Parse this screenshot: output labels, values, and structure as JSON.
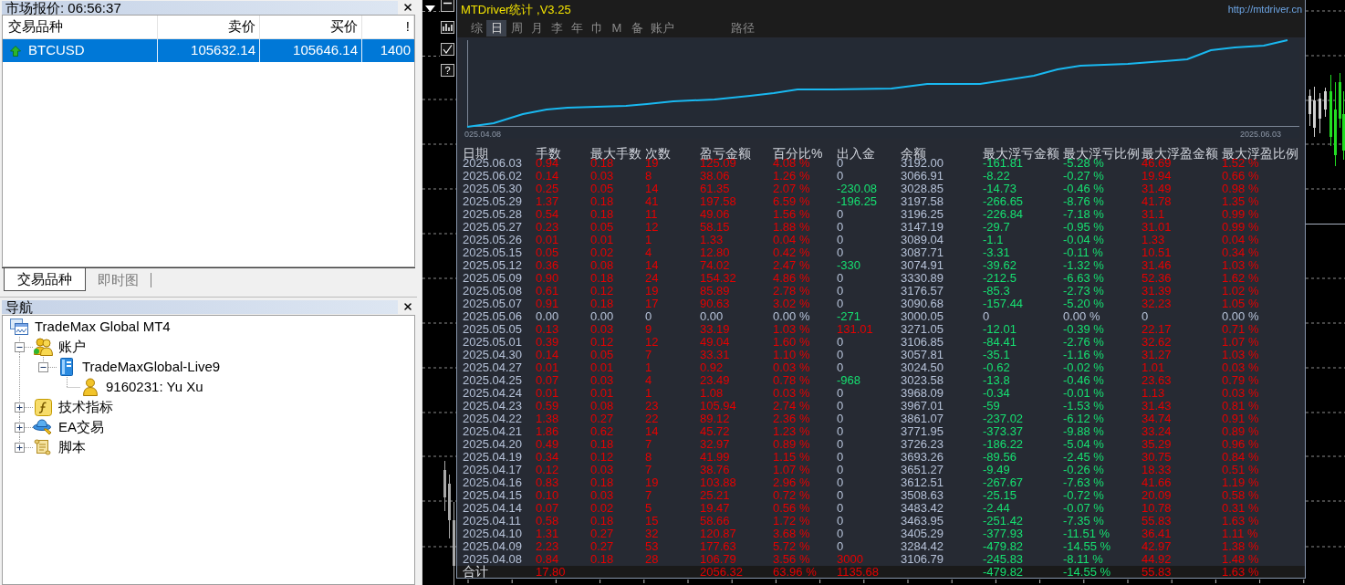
{
  "market_watch": {
    "title": "市场报价: 06:56:37",
    "columns": [
      "交易品种",
      "卖价",
      "买价",
      "!"
    ],
    "rows": [
      {
        "symbol": "BTCUSD",
        "kind": "up",
        "bid": "105632.14",
        "ask": "105646.14",
        "spread": "1400",
        "selected": true
      }
    ],
    "tabs": [
      {
        "label": "交易品种",
        "selected": true
      },
      {
        "label": "即时图",
        "selected": false
      }
    ]
  },
  "navigator": {
    "title": "导航",
    "tree": [
      {
        "label": "TradeMax Global MT4",
        "kind": "terminal",
        "children": [
          {
            "label": "账户",
            "kind": "accounts",
            "expanded": true,
            "children": [
              {
                "label": "TradeMaxGlobal-Live9",
                "kind": "server",
                "expanded": true,
                "children": [
                  {
                    "label": "9160231: Yu Xu",
                    "kind": "user"
                  }
                ]
              }
            ]
          },
          {
            "label": "技术指标",
            "kind": "indicators",
            "expanded": false
          },
          {
            "label": "EA交易",
            "kind": "experts",
            "expanded": false
          },
          {
            "label": "脚本",
            "kind": "scripts",
            "expanded": false
          }
        ]
      }
    ]
  },
  "side_toolbar": {
    "help_label": "?"
  },
  "stats": {
    "title": "MTDriver统计 ,V3.25",
    "link": "http://mtdriver.cn",
    "tabs": [
      {
        "label": "综",
        "selected": false
      },
      {
        "label": "日",
        "selected": true
      },
      {
        "label": "周",
        "selected": false
      },
      {
        "label": "月",
        "selected": false
      },
      {
        "label": "李",
        "selected": false
      },
      {
        "label": "年",
        "selected": false
      },
      {
        "label": "巾",
        "selected": false
      },
      {
        "label": "M",
        "selected": false
      },
      {
        "label": "备",
        "selected": false
      },
      {
        "label": "账户",
        "selected": false
      }
    ],
    "path_button": "路径",
    "curve": {
      "start_label": "025.04.08",
      "end_label": "2025.06.03"
    },
    "columns": [
      {
        "label": "日期",
        "kind": "neutral"
      },
      {
        "label": "手数",
        "kind": "positive"
      },
      {
        "label": "最大手数",
        "kind": "positive"
      },
      {
        "label": "次数",
        "kind": "positive"
      },
      {
        "label": "盈亏金额",
        "kind": "positive"
      },
      {
        "label": "百分比%",
        "kind": "positive"
      },
      {
        "label": "出入金",
        "kind": "flow"
      },
      {
        "label": "余额",
        "kind": "neutral"
      },
      {
        "label": "最大浮亏金额",
        "kind": "negative"
      },
      {
        "label": "最大浮亏比例",
        "kind": "negative"
      },
      {
        "label": "最大浮盈金额",
        "kind": "positive"
      },
      {
        "label": "最大浮盈比例",
        "kind": "positive"
      }
    ],
    "rows": [
      {
        "cells": [
          "2025.06.03",
          "0.94",
          "0.18",
          "19",
          "125.09",
          "4.08 %",
          "0",
          "3192.00",
          "-161.81",
          "-5.28 %",
          "46.69",
          "1.52 %"
        ],
        "idle": false,
        "kind": "none"
      },
      {
        "cells": [
          "2025.06.02",
          "0.14",
          "0.03",
          "8",
          "38.06",
          "1.26 %",
          "0",
          "3066.91",
          "-8.22",
          "-0.27 %",
          "19.94",
          "0.66 %"
        ],
        "idle": false,
        "kind": "none"
      },
      {
        "cells": [
          "2025.05.30",
          "0.25",
          "0.05",
          "14",
          "61.35",
          "2.07 %",
          "-230.08",
          "3028.85",
          "-14.73",
          "-0.46 %",
          "31.49",
          "0.98 %"
        ],
        "idle": false,
        "kind": "withdrawal"
      },
      {
        "cells": [
          "2025.05.29",
          "1.37",
          "0.18",
          "41",
          "197.58",
          "6.59 %",
          "-196.25",
          "3197.58",
          "-266.65",
          "-8.76 %",
          "41.78",
          "1.35 %"
        ],
        "idle": false,
        "kind": "withdrawal"
      },
      {
        "cells": [
          "2025.05.28",
          "0.54",
          "0.18",
          "11",
          "49.06",
          "1.56 %",
          "0",
          "3196.25",
          "-226.84",
          "-7.18 %",
          "31.1",
          "0.99 %"
        ],
        "idle": false,
        "kind": "none"
      },
      {
        "cells": [
          "2025.05.27",
          "0.23",
          "0.05",
          "12",
          "58.15",
          "1.88 %",
          "0",
          "3147.19",
          "-29.7",
          "-0.95 %",
          "31.01",
          "0.99 %"
        ],
        "idle": false,
        "kind": "none"
      },
      {
        "cells": [
          "2025.05.26",
          "0.01",
          "0.01",
          "1",
          "1.33",
          "0.04 %",
          "0",
          "3089.04",
          "-1.1",
          "-0.04 %",
          "1.33",
          "0.04 %"
        ],
        "idle": false,
        "kind": "none"
      },
      {
        "cells": [
          "2025.05.15",
          "0.05",
          "0.02",
          "4",
          "12.80",
          "0.42 %",
          "0",
          "3087.71",
          "-3.31",
          "-0.11 %",
          "10.51",
          "0.34 %"
        ],
        "idle": false,
        "kind": "none"
      },
      {
        "cells": [
          "2025.05.12",
          "0.36",
          "0.08",
          "14",
          "74.02",
          "2.47 %",
          "-330",
          "3074.91",
          "-39.62",
          "-1.32 %",
          "31.46",
          "1.03 %"
        ],
        "idle": false,
        "kind": "withdrawal"
      },
      {
        "cells": [
          "2025.05.09",
          "0.90",
          "0.18",
          "24",
          "154.32",
          "4.86 %",
          "0",
          "3330.89",
          "-212.5",
          "-6.63 %",
          "52.36",
          "1.62 %"
        ],
        "idle": false,
        "kind": "none"
      },
      {
        "cells": [
          "2025.05.08",
          "0.61",
          "0.12",
          "19",
          "85.89",
          "2.78 %",
          "0",
          "3176.57",
          "-85.3",
          "-2.73 %",
          "31.39",
          "1.02 %"
        ],
        "idle": false,
        "kind": "none"
      },
      {
        "cells": [
          "2025.05.07",
          "0.91",
          "0.18",
          "17",
          "90.63",
          "3.02 %",
          "0",
          "3090.68",
          "-157.44",
          "-5.20 %",
          "32.23",
          "1.05 %"
        ],
        "idle": false,
        "kind": "none"
      },
      {
        "cells": [
          "2025.05.06",
          "0.00",
          "0.00",
          "0",
          "0.00",
          "0.00 %",
          "-271",
          "3000.05",
          "0",
          "0.00 %",
          "0",
          "0.00 %"
        ],
        "idle": true,
        "kind": "withdrawal"
      },
      {
        "cells": [
          "2025.05.05",
          "0.13",
          "0.03",
          "9",
          "33.19",
          "1.03 %",
          "131.01",
          "3271.05",
          "-12.01",
          "-0.39 %",
          "22.17",
          "0.71 %"
        ],
        "idle": false,
        "kind": "deposit"
      },
      {
        "cells": [
          "2025.05.01",
          "0.39",
          "0.12",
          "12",
          "49.04",
          "1.60 %",
          "0",
          "3106.85",
          "-84.41",
          "-2.76 %",
          "32.62",
          "1.07 %"
        ],
        "idle": false,
        "kind": "none"
      },
      {
        "cells": [
          "2025.04.30",
          "0.14",
          "0.05",
          "7",
          "33.31",
          "1.10 %",
          "0",
          "3057.81",
          "-35.1",
          "-1.16 %",
          "31.27",
          "1.03 %"
        ],
        "idle": false,
        "kind": "none"
      },
      {
        "cells": [
          "2025.04.27",
          "0.01",
          "0.01",
          "1",
          "0.92",
          "0.03 %",
          "0",
          "3024.50",
          "-0.62",
          "-0.02 %",
          "1.01",
          "0.03 %"
        ],
        "idle": false,
        "kind": "none"
      },
      {
        "cells": [
          "2025.04.25",
          "0.07",
          "0.03",
          "4",
          "23.49",
          "0.78 %",
          "-968",
          "3023.58",
          "-13.8",
          "-0.46 %",
          "23.63",
          "0.79 %"
        ],
        "idle": false,
        "kind": "withdrawal"
      },
      {
        "cells": [
          "2025.04.24",
          "0.01",
          "0.01",
          "1",
          "1.08",
          "0.03 %",
          "0",
          "3968.09",
          "-0.34",
          "-0.01 %",
          "1.13",
          "0.03 %"
        ],
        "idle": false,
        "kind": "none"
      },
      {
        "cells": [
          "2025.04.23",
          "0.59",
          "0.08",
          "23",
          "105.94",
          "2.74 %",
          "0",
          "3967.01",
          "-59",
          "-1.53 %",
          "31.43",
          "0.81 %"
        ],
        "idle": false,
        "kind": "none"
      },
      {
        "cells": [
          "2025.04.22",
          "1.38",
          "0.27",
          "22",
          "89.12",
          "2.36 %",
          "0",
          "3861.07",
          "-237.02",
          "-6.12 %",
          "34.74",
          "0.91 %"
        ],
        "idle": false,
        "kind": "none"
      },
      {
        "cells": [
          "2025.04.21",
          "1.86",
          "0.62",
          "14",
          "45.72",
          "1.23 %",
          "0",
          "3771.95",
          "-373.37",
          "-9.88 %",
          "33.24",
          "0.89 %"
        ],
        "idle": false,
        "kind": "none"
      },
      {
        "cells": [
          "2025.04.20",
          "0.49",
          "0.18",
          "7",
          "32.97",
          "0.89 %",
          "0",
          "3726.23",
          "-186.22",
          "-5.04 %",
          "35.29",
          "0.96 %"
        ],
        "idle": false,
        "kind": "none"
      },
      {
        "cells": [
          "2025.04.19",
          "0.34",
          "0.12",
          "8",
          "41.99",
          "1.15 %",
          "0",
          "3693.26",
          "-89.56",
          "-2.45 %",
          "30.75",
          "0.84 %"
        ],
        "idle": false,
        "kind": "none"
      },
      {
        "cells": [
          "2025.04.17",
          "0.12",
          "0.03",
          "7",
          "38.76",
          "1.07 %",
          "0",
          "3651.27",
          "-9.49",
          "-0.26 %",
          "18.33",
          "0.51 %"
        ],
        "idle": false,
        "kind": "none"
      },
      {
        "cells": [
          "2025.04.16",
          "0.83",
          "0.18",
          "19",
          "103.88",
          "2.96 %",
          "0",
          "3612.51",
          "-267.67",
          "-7.63 %",
          "41.66",
          "1.19 %"
        ],
        "idle": false,
        "kind": "none"
      },
      {
        "cells": [
          "2025.04.15",
          "0.10",
          "0.03",
          "7",
          "25.21",
          "0.72 %",
          "0",
          "3508.63",
          "-25.15",
          "-0.72 %",
          "20.09",
          "0.58 %"
        ],
        "idle": false,
        "kind": "none"
      },
      {
        "cells": [
          "2025.04.14",
          "0.07",
          "0.02",
          "5",
          "19.47",
          "0.56 %",
          "0",
          "3483.42",
          "-2.44",
          "-0.07 %",
          "10.78",
          "0.31 %"
        ],
        "idle": false,
        "kind": "none"
      },
      {
        "cells": [
          "2025.04.11",
          "0.58",
          "0.18",
          "15",
          "58.66",
          "1.72 %",
          "0",
          "3463.95",
          "-251.42",
          "-7.35 %",
          "55.83",
          "1.63 %"
        ],
        "idle": false,
        "kind": "none"
      },
      {
        "cells": [
          "2025.04.10",
          "1.31",
          "0.27",
          "32",
          "120.87",
          "3.68 %",
          "0",
          "3405.29",
          "-377.93",
          "-11.51 %",
          "36.41",
          "1.11 %"
        ],
        "idle": false,
        "kind": "none"
      },
      {
        "cells": [
          "2025.04.09",
          "2.23",
          "0.27",
          "53",
          "177.63",
          "5.72 %",
          "0",
          "3284.42",
          "-479.82",
          "-14.55 %",
          "42.97",
          "1.38 %"
        ],
        "idle": false,
        "kind": "none"
      },
      {
        "cells": [
          "2025.04.08",
          "0.84",
          "0.18",
          "28",
          "106.79",
          "3.56 %",
          "3000",
          "3106.79",
          "-245.83",
          "-8.11 %",
          "44.92",
          "1.48 %"
        ],
        "idle": false,
        "kind": "deposit"
      }
    ],
    "total": {
      "cells": [
        "合计",
        "17.80",
        null,
        null,
        "2056.32",
        "63.96 %",
        "1135.68",
        null,
        "-479.82",
        "-14.55 %",
        "55.83",
        "1.63 %"
      ],
      "kind": "deposit"
    }
  }
}
